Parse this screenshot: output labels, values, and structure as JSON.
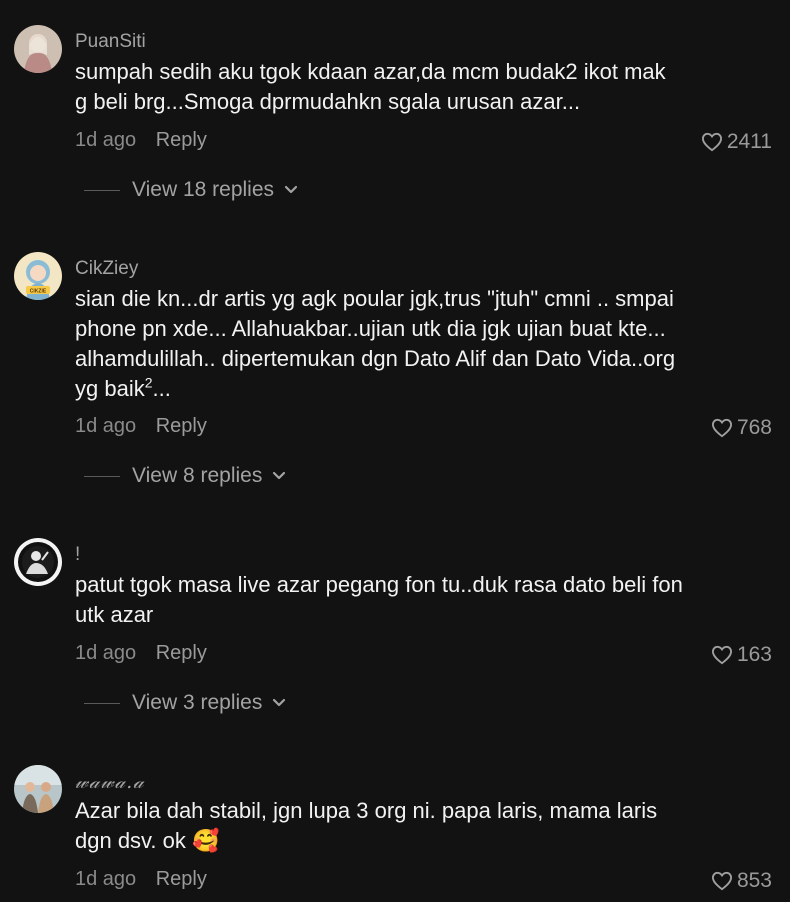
{
  "comments": [
    {
      "username": "PuanSiti",
      "text": "sumpah sedih aku tgok kdaan azar,da mcm budak2 ikot mak g beli brg...Smoga dprmudahkn sgala urusan azar...",
      "time": "1d ago",
      "reply_label": "Reply",
      "likes": "2411",
      "view_replies": "View 18 replies"
    },
    {
      "username": "CikZiey",
      "text_main": "sian die kn...dr artis yg agk poular jgk,trus \"jtuh\" cmni .. smpai phone pn xde... Allahuakbar..ujian utk dia jgk ujian buat kte... alhamdulillah.. dipertemukan dgn Dato Alif dan Dato Vida..org yg baik",
      "text_sup": "2",
      "text_tail": "...",
      "avatar_badge": "CIKZIE",
      "time": "1d ago",
      "reply_label": "Reply",
      "likes": "768",
      "view_replies": "View 8 replies"
    },
    {
      "username": "!",
      "text": "patut tgok masa live azar pegang fon tu..duk rasa dato beli fon utk azar",
      "time": "1d ago",
      "reply_label": "Reply",
      "likes": "163",
      "view_replies": "View 3 replies"
    },
    {
      "username": "𝓌𝒶𝓌𝒶.𝒶",
      "text": "Azar bila dah stabil, jgn lupa 3 org ni. papa laris, mama laris dgn dsv. ok 🥰",
      "time": "1d ago",
      "reply_label": "Reply",
      "likes": "853"
    }
  ],
  "icons": {
    "heart": "heart-outline-icon",
    "chevron": "chevron-down-icon"
  },
  "colors": {
    "background": "#121212",
    "text": "#f2f2f2",
    "muted": "#8a8a8a"
  }
}
